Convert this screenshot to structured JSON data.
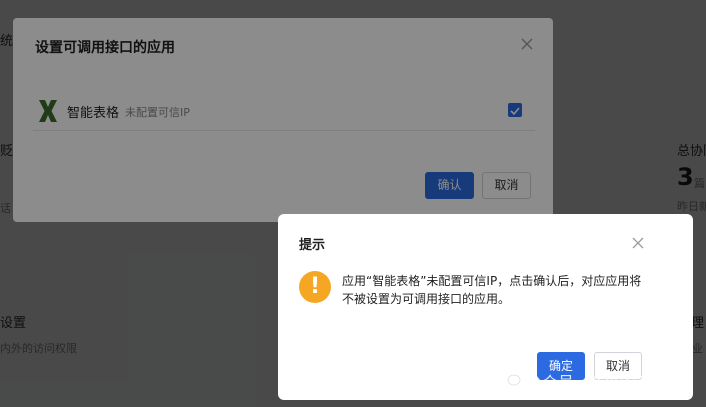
{
  "background": {
    "left_title_fragment": "统",
    "left_label_fragment": "贬",
    "left_sub_fragment": "话",
    "right_label": "总协同",
    "right_count": "3",
    "right_count_unit": "篇",
    "right_sub": "昨日新",
    "section_left_title": "设置",
    "section_left_sub": "内外的访问权限",
    "section_right_title": "档管理",
    "section_right_sub": "外企业"
  },
  "dialog_apps": {
    "title": "设置可调用接口的应用",
    "app": {
      "name": "智能表格",
      "tag": "未配置可信IP",
      "checked": true
    },
    "confirm_label": "确认",
    "cancel_label": "取消"
  },
  "dialog_tip": {
    "title": "提示",
    "message": "应用“智能表格”未配置可信IP，点击确认后，对应应用将不被设置为可调用接口的应用。",
    "ok_label": "确定",
    "cancel_label": "取消"
  },
  "watermark": {
    "text": "公众号 · IT小农工"
  },
  "colors": {
    "primary": "#2b6ae0",
    "warning": "#f5a623",
    "app_logo": "#3d6b2a"
  }
}
